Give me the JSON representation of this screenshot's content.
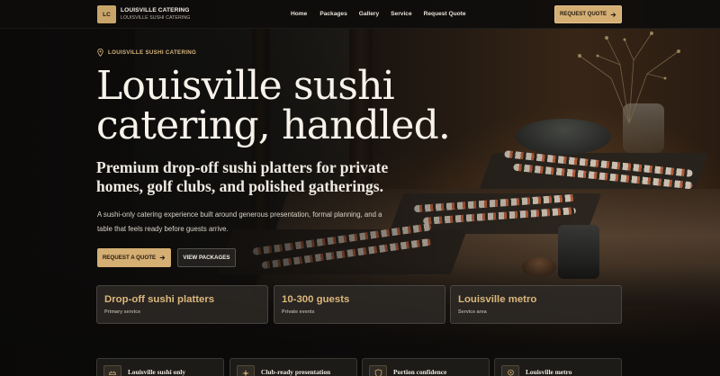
{
  "brand": {
    "initials": "LC",
    "name": "LOUISVILLE CATERING",
    "tagline": "LOUISVILLE SUSHI CATERING"
  },
  "nav": {
    "items": [
      {
        "label": "Home"
      },
      {
        "label": "Packages"
      },
      {
        "label": "Gallery"
      },
      {
        "label": "Service"
      },
      {
        "label": "Request Quote"
      }
    ]
  },
  "header_cta": {
    "label": "REQUEST QUOTE",
    "icon": "arrow-right-icon"
  },
  "hero": {
    "eyebrow": "LOUISVILLE SUSHI CATERING",
    "eyebrow_icon": "location-pin-icon",
    "headline": "Louisville sushi catering, handled.",
    "subheadline": "Premium drop-off sushi platters for private homes, golf clubs, and polished gatherings.",
    "body": "A sushi-only catering experience built around generous presentation, formal planning, and a table that feels ready before guests arrive.",
    "primary_button": "REQUEST A QUOTE",
    "secondary_button": "VIEW PACKAGES"
  },
  "stats": [
    {
      "value": "Drop-off sushi platters",
      "label": "Primary service"
    },
    {
      "value": "10-300 guests",
      "label": "Private events"
    },
    {
      "value": "Louisville metro",
      "label": "Service area"
    }
  ],
  "features": [
    {
      "title": "Louisville sushi only",
      "icon": "tray-icon"
    },
    {
      "title": "Club-ready presentation",
      "icon": "sparkle-icon"
    },
    {
      "title": "Portion confidence",
      "icon": "shield-icon"
    },
    {
      "title": "Louisville metro",
      "icon": "pin-icon"
    }
  ],
  "colors": {
    "accent": "#d4ae73",
    "background": "#0e0d0b",
    "stat_value": "#dcb77c"
  }
}
